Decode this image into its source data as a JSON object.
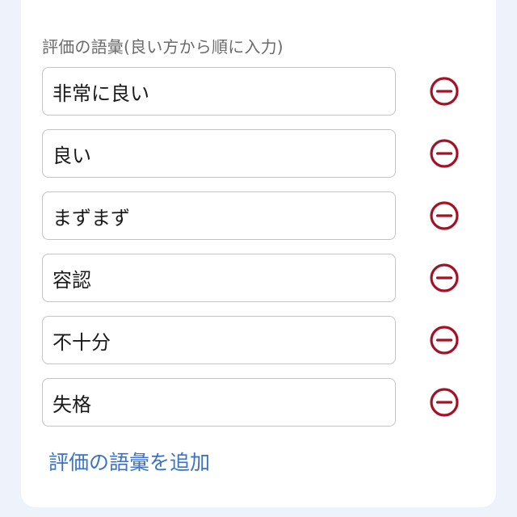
{
  "section_label": "評価の語彙(良い方から順に入力)",
  "terms": [
    {
      "value": "非常に良い"
    },
    {
      "value": "良い"
    },
    {
      "value": "まずまず"
    },
    {
      "value": "容認"
    },
    {
      "value": "不十分"
    },
    {
      "value": "失格"
    }
  ],
  "remove_icon": "minus-circle-icon",
  "add_link_label": "評価の語彙を追加",
  "colors": {
    "remove_icon": "#a31327",
    "link": "#3b72c7",
    "background": "#eef3fb",
    "card": "#ffffff",
    "border": "#c4c4c4"
  }
}
